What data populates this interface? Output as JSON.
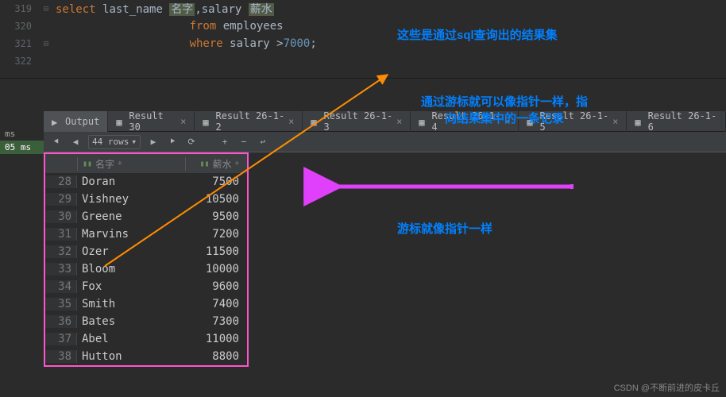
{
  "gutter": {
    "l1": "319",
    "l2": "320",
    "l3": "321",
    "l4": "322"
  },
  "sql": {
    "kw_select": "select ",
    "c1": "last_name ",
    "a1": "名字",
    "comma": ",",
    "c2": "salary ",
    "a2": "薪水",
    "kw_from": "from ",
    "t": "employees",
    "kw_where": "where ",
    "c3": "salary ",
    "op": ">",
    "n": "7000",
    "semi": ";"
  },
  "tabs": {
    "output": "Output",
    "r1": "Result 30",
    "r2": "Result 26-1-2",
    "r3": "Result 26-1-3",
    "r4": "Result 26-1-4",
    "r5": "Result 26-1-5",
    "r6": "Result 26-1-6"
  },
  "toolbar": {
    "rows": "44 rows"
  },
  "left": {
    "ms": "ms",
    "t": "05 ms"
  },
  "headers": {
    "name": "名字",
    "salary": "薪水"
  },
  "chart_data": {
    "type": "table",
    "columns": [
      "#",
      "名字",
      "薪水"
    ],
    "rows": [
      {
        "idx": 28,
        "name": "Doran",
        "salary": 7500
      },
      {
        "idx": 29,
        "name": "Vishney",
        "salary": 10500
      },
      {
        "idx": 30,
        "name": "Greene",
        "salary": 9500
      },
      {
        "idx": 31,
        "name": "Marvins",
        "salary": 7200
      },
      {
        "idx": 32,
        "name": "Ozer",
        "salary": 11500
      },
      {
        "idx": 33,
        "name": "Bloom",
        "salary": 10000
      },
      {
        "idx": 34,
        "name": "Fox",
        "salary": 9600
      },
      {
        "idx": 35,
        "name": "Smith",
        "salary": 7400
      },
      {
        "idx": 36,
        "name": "Bates",
        "salary": 7300
      },
      {
        "idx": 37,
        "name": "Abel",
        "salary": 11000
      },
      {
        "idx": 38,
        "name": "Hutton",
        "salary": 8800
      }
    ]
  },
  "ann": {
    "a1": "这些是通过sql查询出的结果集",
    "a2": "通过游标就可以像指针一样，指向结果集中的一条记录",
    "a3": "游标就像指针一样"
  },
  "watermark": "CSDN @不断前进的皮卡丘"
}
